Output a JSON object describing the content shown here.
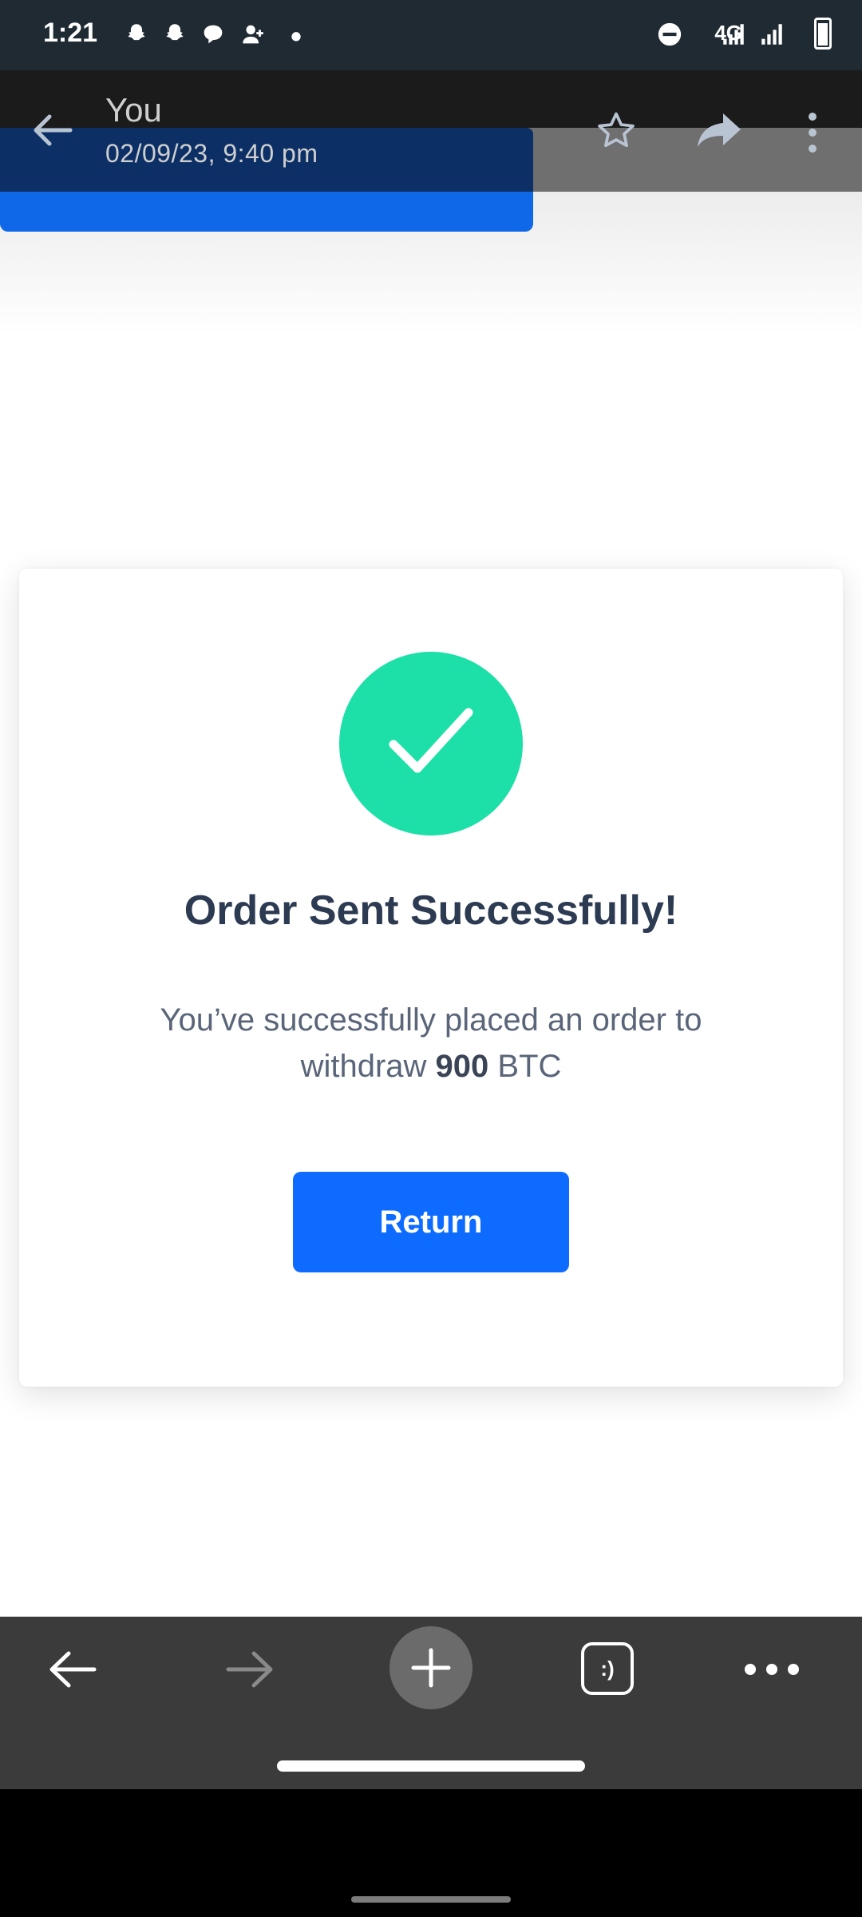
{
  "status_bar": {
    "time": "1:21",
    "network": "4G",
    "icons": [
      "snapchat-icon",
      "snapchat-icon",
      "chat-icon",
      "add-person-icon",
      "dot-icon",
      "do-not-disturb-icon",
      "signal-icon",
      "signal-icon",
      "battery-icon"
    ]
  },
  "viewer": {
    "sender": "You",
    "timestamp": "02/09/23, 9:40 pm",
    "icons": [
      "back-arrow-icon",
      "star-icon",
      "share-icon",
      "more-vertical-icon"
    ]
  },
  "card": {
    "title": "Order Sent Successfully!",
    "message_prefix": "You’ve successfully placed an order to",
    "message_line2_prefix": "withdraw ",
    "amount": "900",
    "currency": " BTC",
    "button_label": "Return",
    "accent": "#1de0a8",
    "button_color": "#0d6cff"
  },
  "browser_bar": {
    "tabs_label": ":)",
    "icons": [
      "back-arrow-icon",
      "forward-arrow-icon",
      "plus-icon",
      "tabs-icon",
      "more-horizontal-icon"
    ]
  }
}
